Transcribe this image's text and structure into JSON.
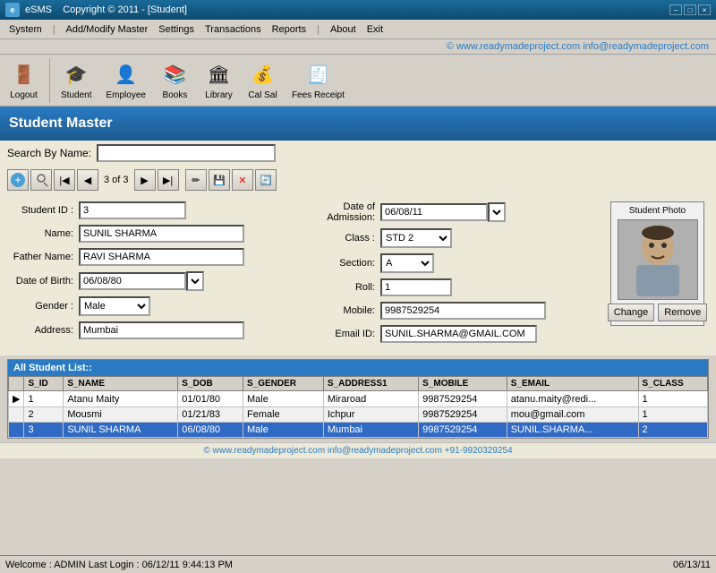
{
  "titlebar": {
    "app_name": "eSMS",
    "copyright": "Copyright © 2011 - [Student]",
    "minimize": "−",
    "maximize": "□",
    "close": "×"
  },
  "menubar": {
    "items": [
      {
        "label": "System",
        "id": "system"
      },
      {
        "label": "|",
        "id": "sep1"
      },
      {
        "label": "Add/Modify Master",
        "id": "add-modify"
      },
      {
        "label": "Settings",
        "id": "settings"
      },
      {
        "label": "Transactions",
        "id": "transactions"
      },
      {
        "label": "Reports",
        "id": "reports"
      },
      {
        "label": "|",
        "id": "sep2"
      },
      {
        "label": "About",
        "id": "about"
      },
      {
        "label": "Exit",
        "id": "exit"
      }
    ]
  },
  "toolbar": {
    "buttons": [
      {
        "label": "Logout",
        "icon": "🚪",
        "id": "logout"
      },
      {
        "label": "Student",
        "icon": "🎓",
        "id": "student"
      },
      {
        "label": "Employee",
        "icon": "👤",
        "id": "employee"
      },
      {
        "label": "Books",
        "icon": "📚",
        "id": "books"
      },
      {
        "label": "Library",
        "icon": "🏛",
        "id": "library"
      },
      {
        "label": "Cal Sal",
        "icon": "💰",
        "id": "calsal"
      },
      {
        "label": "Fees Receipt",
        "icon": "🧾",
        "id": "feesreceipt"
      }
    ]
  },
  "watermark": "© www.readymadeproject.com  info@readymadeproject.com",
  "header": {
    "title": "Student Master"
  },
  "search": {
    "label": "Search By Name:",
    "placeholder": ""
  },
  "navigation": {
    "counter": "3 of 3"
  },
  "form": {
    "student_id_label": "Student ID :",
    "student_id_value": "3",
    "name_label": "Name:",
    "name_value": "SUNIL SHARMA",
    "father_name_label": "Father Name:",
    "father_name_value": "RAVI SHARMA",
    "dob_label": "Date of Birth:",
    "dob_value": "06/08/80",
    "gender_label": "Gender :",
    "gender_value": "Male",
    "address_label": "Address:",
    "address_value": "Mumbai",
    "doa_label": "Date of Admission:",
    "doa_value": "06/08/11",
    "class_label": "Class :",
    "class_value": "STD 2",
    "section_label": "Section:",
    "section_value": "A",
    "roll_label": "Roll:",
    "roll_value": "1",
    "mobile_label": "Mobile:",
    "mobile_value": "9987529254",
    "email_label": "Email ID:",
    "email_value": "SUNIL.SHARMA@GMAIL.COM",
    "photo_label": "Student Photo",
    "change_label": "Change",
    "remove_label": "Remove"
  },
  "table": {
    "title": "All Student List::",
    "columns": [
      "",
      "S_ID",
      "S_NAME",
      "S_DOB",
      "S_GENDER",
      "S_ADDRESS1",
      "S_MOBILE",
      "S_EMAIL",
      "S_CLASS"
    ],
    "rows": [
      {
        "indicator": "▶",
        "sid": "1",
        "name": "Atanu Maity",
        "dob": "01/01/80",
        "gender": "Male",
        "address": "Miraroad",
        "mobile": "9987529254",
        "email": "atanu.maity@redi...",
        "class": "1",
        "selected": false
      },
      {
        "indicator": "",
        "sid": "2",
        "name": "Mousmi",
        "dob": "01/21/83",
        "gender": "Female",
        "address": "Ichpur",
        "mobile": "9987529254",
        "email": "mou@gmail.com",
        "class": "1",
        "selected": false
      },
      {
        "indicator": "",
        "sid": "3",
        "name": "SUNIL SHARMA",
        "dob": "06/08/80",
        "gender": "Male",
        "address": "Mumbai",
        "mobile": "9987529254",
        "email": "SUNIL.SHARMA...",
        "class": "2",
        "selected": true
      }
    ]
  },
  "footer_link": "© www.readymadeproject.com  info@readymadeproject.com  +91-9920329254",
  "statusbar": {
    "left": "Welcome : ADMIN  Last Login : 06/12/11  9:44:13 PM",
    "right": "06/13/11"
  }
}
